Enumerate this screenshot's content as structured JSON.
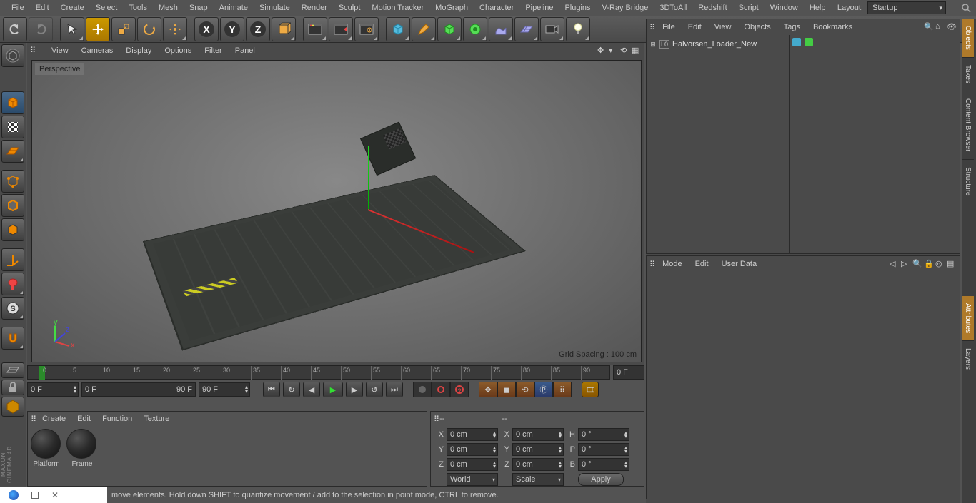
{
  "menu": {
    "items": [
      "File",
      "Edit",
      "Create",
      "Select",
      "Tools",
      "Mesh",
      "Snap",
      "Animate",
      "Simulate",
      "Render",
      "Sculpt",
      "Motion Tracker",
      "MoGraph",
      "Character",
      "Pipeline",
      "Plugins",
      "V-Ray Bridge",
      "3DToAll",
      "Redshift",
      "Script",
      "Window",
      "Help"
    ],
    "layout_label": "Layout:",
    "layout_value": "Startup"
  },
  "viewport": {
    "menus": [
      "View",
      "Cameras",
      "Display",
      "Options",
      "Filter",
      "Panel"
    ],
    "mode": "Perspective",
    "grid": "Grid Spacing : 100 cm"
  },
  "objects_panel": {
    "menus": [
      "File",
      "Edit",
      "View",
      "Objects",
      "Tags",
      "Bookmarks"
    ],
    "item": "Halvorsen_Loader_New"
  },
  "attr_panel": {
    "menus": [
      "Mode",
      "Edit",
      "User Data"
    ]
  },
  "right_tabs": [
    "Objects",
    "Takes",
    "Content Browser",
    "Structure",
    "Attributes",
    "Layers"
  ],
  "timeline": {
    "ticks": [
      "0",
      "5",
      "10",
      "15",
      "20",
      "25",
      "30",
      "35",
      "40",
      "45",
      "50",
      "55",
      "60",
      "65",
      "70",
      "75",
      "80",
      "85",
      "90"
    ],
    "cur": "0 F",
    "range_min": "0 F",
    "range_max": "90 F",
    "end": "90 F",
    "end2": "0 F"
  },
  "materials": {
    "menus": [
      "Create",
      "Edit",
      "Function",
      "Texture"
    ],
    "items": [
      "Platform",
      "Frame"
    ]
  },
  "coord": {
    "dash": "--",
    "x": "0 cm",
    "y": "0 cm",
    "z": "0 cm",
    "h": "0 °",
    "p": "0 °",
    "b": "0 °",
    "world": "World",
    "scale": "Scale",
    "apply": "Apply"
  },
  "status": "move elements. Hold down SHIFT to quantize movement / add to the selection in point mode, CTRL to remove.",
  "labels": {
    "X": "X",
    "Y": "Y",
    "Z": "Z",
    "H": "H",
    "P": "P",
    "B": "B"
  }
}
